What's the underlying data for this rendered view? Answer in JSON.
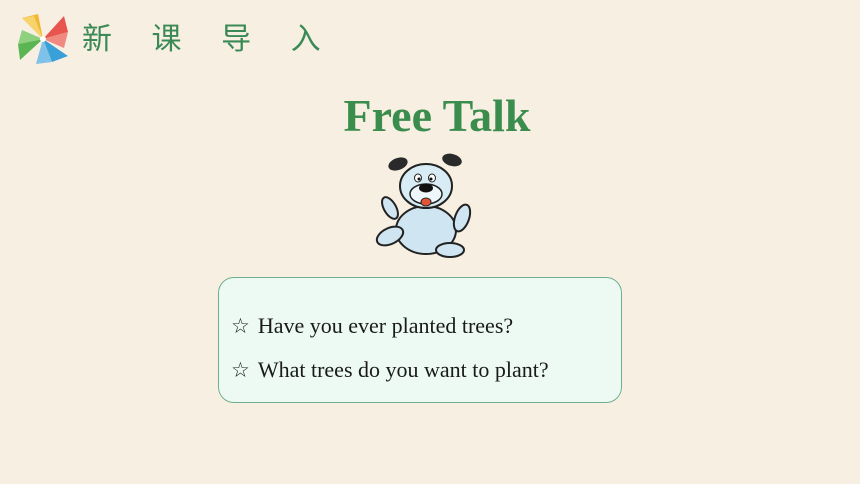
{
  "header": {
    "logo_icon": "pinwheel-icon",
    "title": "新 课 导 入"
  },
  "slide": {
    "title": "Free Talk",
    "mascot_icon": "cartoon-dog",
    "questions": [
      {
        "bullet": "☆",
        "text": "Have you ever planted trees?"
      },
      {
        "bullet": "☆",
        "text": "What trees do you want to plant?"
      }
    ]
  },
  "colors": {
    "background": "#f8efe3",
    "title_green": "#3b8d4d",
    "box_fill": "#ecfaf3",
    "box_border": "#6fb08c"
  }
}
